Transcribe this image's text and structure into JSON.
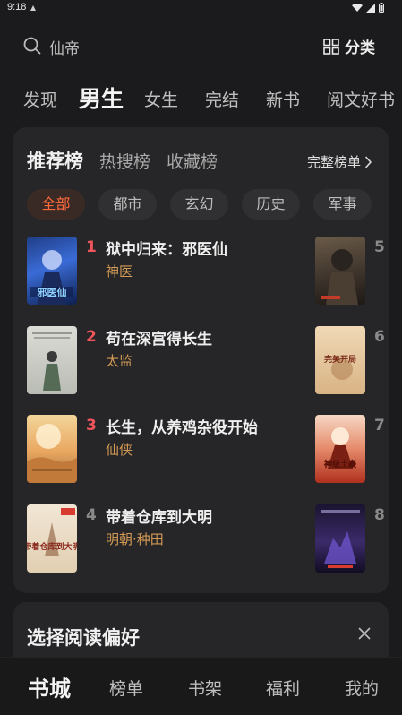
{
  "status": {
    "time": "9:18"
  },
  "search": {
    "query": "仙帝"
  },
  "category": {
    "label": "分类"
  },
  "top_tabs": [
    "发现",
    "男生",
    "女生",
    "完结",
    "新书",
    "阅文好书"
  ],
  "rank": {
    "tabs": [
      "推荐榜",
      "热搜榜",
      "收藏榜"
    ],
    "full_list": "完整榜单",
    "filters": [
      "全部",
      "都市",
      "玄幻",
      "历史",
      "军事"
    ],
    "books": [
      {
        "rank": "1",
        "title": "狱中归来：邪医仙",
        "tag": "神医",
        "cover_text": "邪医仙"
      },
      {
        "rank": "2",
        "title": "苟在深宫得长生",
        "tag": "太监",
        "cover_text": ""
      },
      {
        "rank": "3",
        "title": "长生，从养鸡杂役开始",
        "tag": "仙侠",
        "cover_text": ""
      },
      {
        "rank": "4",
        "title": "带着仓库到大明",
        "tag": "明朝·种田",
        "cover_text": "带着仓库到大明"
      }
    ],
    "side_books": [
      {
        "rank": "5",
        "cover_text": ""
      },
      {
        "rank": "6",
        "cover_text": "完美开局"
      },
      {
        "rank": "7",
        "cover_text": "神级土豪"
      },
      {
        "rank": "8",
        "cover_text": ""
      }
    ]
  },
  "preference": {
    "title": "选择阅读偏好"
  },
  "bottom_nav": [
    "书城",
    "榜单",
    "书架",
    "福利",
    "我的"
  ],
  "colors": {
    "accent": "#ff6a3d",
    "rank_top": "#f2545b",
    "tag": "#d29a55"
  }
}
